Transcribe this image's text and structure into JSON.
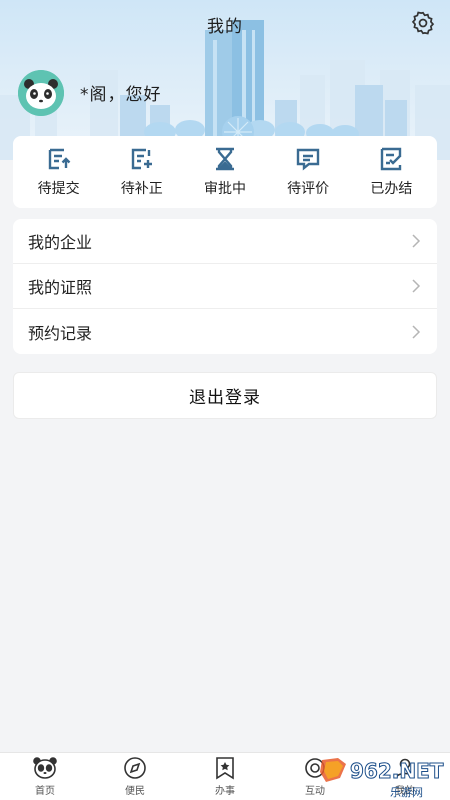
{
  "header": {
    "title": "我的"
  },
  "user": {
    "greeting": "*阁，您好"
  },
  "status": [
    {
      "label": "待提交",
      "icon": "doc-upload-icon"
    },
    {
      "label": "待补正",
      "icon": "doc-add-icon"
    },
    {
      "label": "审批中",
      "icon": "hourglass-icon"
    },
    {
      "label": "待评价",
      "icon": "comment-icon"
    },
    {
      "label": "已办结",
      "icon": "doc-check-icon"
    }
  ],
  "menu": [
    {
      "label": "我的企业"
    },
    {
      "label": "我的证照"
    },
    {
      "label": "预约记录"
    }
  ],
  "logout": {
    "label": "退出登录"
  },
  "nav": [
    {
      "label": "首页",
      "icon": "panda-icon"
    },
    {
      "label": "便民",
      "icon": "compass-icon"
    },
    {
      "label": "办事",
      "icon": "bookmark-star-icon"
    },
    {
      "label": "互动",
      "icon": "chat-icon"
    },
    {
      "label": "我的",
      "icon": "user-icon"
    }
  ],
  "watermark": {
    "logo_text": "962.NET",
    "sub_text": "乐游网"
  },
  "colors": {
    "accent": "#2c5f8a",
    "icon_blue": "#3a6b92",
    "avatar_bg": "#5ec3b2"
  }
}
